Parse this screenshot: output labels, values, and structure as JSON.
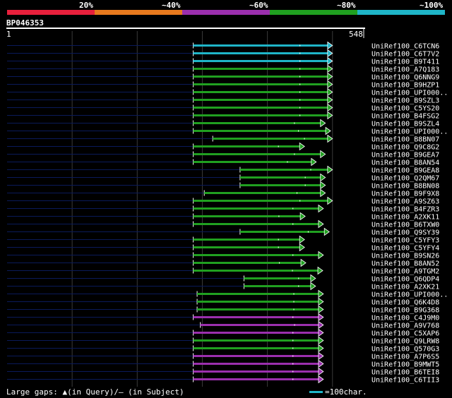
{
  "legend": {
    "labels": [
      "20%",
      "~40%",
      "~60%",
      "~80%",
      "~100%"
    ],
    "colors": [
      "#e8203c",
      "#e87a1e",
      "#9b2fae",
      "#20a020",
      "#1fb5c8"
    ]
  },
  "query": {
    "name": "BP046353",
    "start": "1",
    "end": "548",
    "length": 548
  },
  "hits": [
    {
      "id": "UniRef100_C6TCN6",
      "start": 286,
      "end": 499,
      "color": "#1fb5c8"
    },
    {
      "id": "UniRef100_C6T7V2",
      "start": 286,
      "end": 499,
      "color": "#1fb5c8"
    },
    {
      "id": "UniRef100_B9T411",
      "start": 286,
      "end": 499,
      "color": "#1fb5c8"
    },
    {
      "id": "UniRef100_A7Q183",
      "start": 286,
      "end": 499,
      "color": "#20a020"
    },
    {
      "id": "UniRef100_Q6NNG9",
      "start": 286,
      "end": 499,
      "color": "#20a020"
    },
    {
      "id": "UniRef100_B9HZP1",
      "start": 286,
      "end": 499,
      "color": "#20a020"
    },
    {
      "id": "UniRef100_UPI000..",
      "start": 286,
      "end": 499,
      "color": "#20a020"
    },
    {
      "id": "UniRef100_B9SZL3",
      "start": 286,
      "end": 499,
      "color": "#20a020"
    },
    {
      "id": "UniRef100_C5YS20",
      "start": 286,
      "end": 499,
      "color": "#20a020"
    },
    {
      "id": "UniRef100_B4FSG2",
      "start": 286,
      "end": 499,
      "color": "#20a020"
    },
    {
      "id": "UniRef100_B9SZL4",
      "start": 286,
      "end": 488,
      "color": "#20a020"
    },
    {
      "id": "UniRef100_UPI000..",
      "start": 286,
      "end": 496,
      "color": "#20a020"
    },
    {
      "id": "UniRef100_B8BN07",
      "start": 316,
      "end": 499,
      "color": "#20a020"
    },
    {
      "id": "UniRef100_Q9C8G2",
      "start": 286,
      "end": 456,
      "color": "#20a020"
    },
    {
      "id": "UniRef100_B9GEA7",
      "start": 286,
      "end": 488,
      "color": "#20a020"
    },
    {
      "id": "UniRef100_B8AN54",
      "start": 286,
      "end": 474,
      "color": "#20a020"
    },
    {
      "id": "UniRef100_B9GEA8",
      "start": 358,
      "end": 499,
      "color": "#20a020"
    },
    {
      "id": "UniRef100_Q2QM67",
      "start": 358,
      "end": 488,
      "color": "#20a020"
    },
    {
      "id": "UniRef100_B8BN08",
      "start": 358,
      "end": 488,
      "color": "#20a020"
    },
    {
      "id": "UniRef100_B9F9X8",
      "start": 303,
      "end": 488,
      "color": "#20a020"
    },
    {
      "id": "UniRef100_A9SZ63",
      "start": 286,
      "end": 499,
      "color": "#20a020"
    },
    {
      "id": "UniRef100_B4FZR3",
      "start": 286,
      "end": 485,
      "color": "#20a020"
    },
    {
      "id": "UniRef100_A2XK11",
      "start": 286,
      "end": 457,
      "color": "#20a020"
    },
    {
      "id": "UniRef100_B6TXW0",
      "start": 286,
      "end": 485,
      "color": "#20a020"
    },
    {
      "id": "UniRef100_Q9SY39",
      "start": 358,
      "end": 494,
      "color": "#20a020"
    },
    {
      "id": "UniRef100_C5YFY3",
      "start": 286,
      "end": 456,
      "color": "#20a020"
    },
    {
      "id": "UniRef100_C5YFY4",
      "start": 286,
      "end": 456,
      "color": "#20a020"
    },
    {
      "id": "UniRef100_B9SN26",
      "start": 286,
      "end": 485,
      "color": "#20a020"
    },
    {
      "id": "UniRef100_B8AN52",
      "start": 286,
      "end": 458,
      "color": "#20a020"
    },
    {
      "id": "UniRef100_A9TGM2",
      "start": 286,
      "end": 484,
      "color": "#20a020"
    },
    {
      "id": "UniRef100_Q6QDP4",
      "start": 364,
      "end": 473,
      "color": "#20a020"
    },
    {
      "id": "UniRef100_A2XK21",
      "start": 364,
      "end": 473,
      "color": "#20a020"
    },
    {
      "id": "UniRef100_UPI000..",
      "start": 292,
      "end": 485,
      "color": "#20a020"
    },
    {
      "id": "UniRef100_Q6K4D8",
      "start": 292,
      "end": 485,
      "color": "#20a020"
    },
    {
      "id": "UniRef100_B9G368",
      "start": 292,
      "end": 485,
      "color": "#20a020"
    },
    {
      "id": "UniRef100_C4J9M0",
      "start": 286,
      "end": 485,
      "color": "#9b2fae"
    },
    {
      "id": "UniRef100_A9V768",
      "start": 297,
      "end": 485,
      "color": "#9b2fae"
    },
    {
      "id": "UniRef100_C5XAP6",
      "start": 286,
      "end": 485,
      "color": "#9b2fae"
    },
    {
      "id": "UniRef100_Q9LRW8",
      "start": 286,
      "end": 485,
      "color": "#20a020"
    },
    {
      "id": "UniRef100_Q570G3",
      "start": 286,
      "end": 485,
      "color": "#20a020"
    },
    {
      "id": "UniRef100_A7P6S5",
      "start": 286,
      "end": 485,
      "color": "#9b2fae"
    },
    {
      "id": "UniRef100_B9MWT5",
      "start": 286,
      "end": 485,
      "color": "#9b2fae"
    },
    {
      "id": "UniRef100_B6TEI8",
      "start": 286,
      "end": 485,
      "color": "#9b2fae"
    },
    {
      "id": "UniRef100_C6TII3",
      "start": 286,
      "end": 485,
      "color": "#9b2fae"
    }
  ],
  "footer": {
    "gaps_text": "Large gaps: ▲(in Query)/– (in Subject)",
    "scale_text": "=100char."
  }
}
